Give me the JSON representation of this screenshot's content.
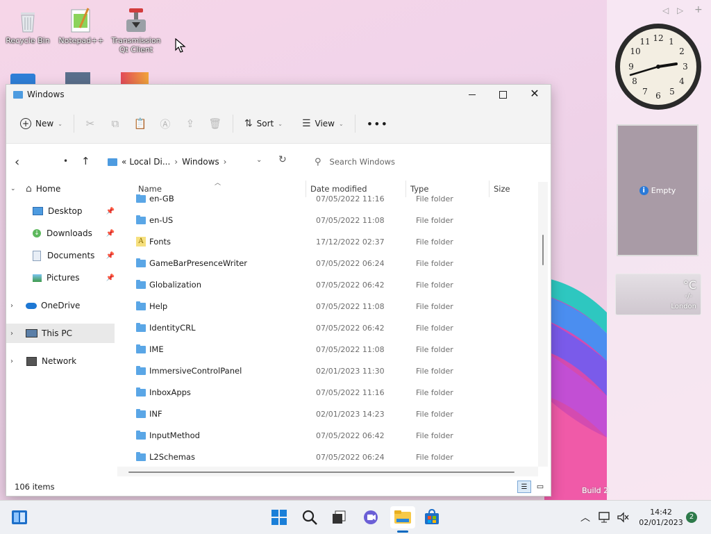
{
  "desktop": {
    "icons": [
      {
        "label": "Recycle Bin"
      },
      {
        "label": "Notepad++"
      },
      {
        "label": "Transmission Qt Client"
      }
    ],
    "watermark": "Build 2"
  },
  "gadgets": {
    "slideshow_label": "Empty",
    "weather_temp": "°C",
    "weather_value": "-/-",
    "weather_city": "London"
  },
  "window": {
    "title": "Windows",
    "toolbar": {
      "new_label": "New",
      "sort_label": "Sort",
      "view_label": "View"
    },
    "address": {
      "overflow": "«",
      "crumbs": [
        "Local Di...",
        "Windows"
      ],
      "search_placeholder": "Search Windows"
    },
    "columns": [
      "Name",
      "Date modified",
      "Type",
      "Size"
    ],
    "nav": [
      {
        "label": "Home"
      },
      {
        "label": "Desktop"
      },
      {
        "label": "Downloads"
      },
      {
        "label": "Documents"
      },
      {
        "label": "Pictures"
      },
      {
        "label": "OneDrive"
      },
      {
        "label": "This PC"
      },
      {
        "label": "Network"
      }
    ],
    "files": [
      {
        "name": "en-GB",
        "date": "07/05/2022 11:16",
        "type": "File folder"
      },
      {
        "name": "en-US",
        "date": "07/05/2022 11:08",
        "type": "File folder"
      },
      {
        "name": "Fonts",
        "date": "17/12/2022 02:37",
        "type": "File folder"
      },
      {
        "name": "GameBarPresenceWriter",
        "date": "07/05/2022 06:24",
        "type": "File folder"
      },
      {
        "name": "Globalization",
        "date": "07/05/2022 06:42",
        "type": "File folder"
      },
      {
        "name": "Help",
        "date": "07/05/2022 11:08",
        "type": "File folder"
      },
      {
        "name": "IdentityCRL",
        "date": "07/05/2022 06:42",
        "type": "File folder"
      },
      {
        "name": "IME",
        "date": "07/05/2022 11:08",
        "type": "File folder"
      },
      {
        "name": "ImmersiveControlPanel",
        "date": "02/01/2023 11:30",
        "type": "File folder"
      },
      {
        "name": "InboxApps",
        "date": "07/05/2022 11:16",
        "type": "File folder"
      },
      {
        "name": "INF",
        "date": "02/01/2023 14:23",
        "type": "File folder"
      },
      {
        "name": "InputMethod",
        "date": "07/05/2022 06:42",
        "type": "File folder"
      },
      {
        "name": "L2Schemas",
        "date": "07/05/2022 06:24",
        "type": "File folder"
      }
    ],
    "status": "106 items"
  },
  "taskbar": {
    "time": "14:42",
    "date": "02/01/2023",
    "notification_count": "2"
  },
  "colors": {
    "accent": "#0067c0",
    "folder": "#5aa6e6",
    "selected_nav": "#e9e9e9"
  }
}
